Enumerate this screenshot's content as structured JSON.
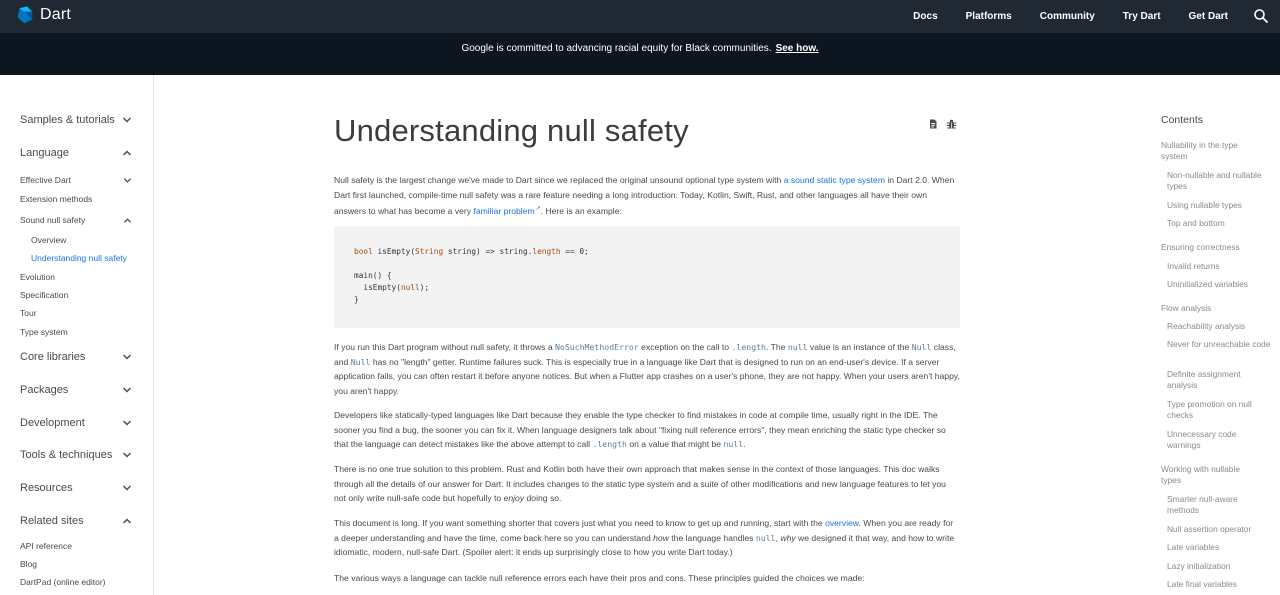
{
  "header": {
    "brand": "Dart",
    "nav": [
      "Docs",
      "Platforms",
      "Community",
      "Try Dart",
      "Get Dart"
    ]
  },
  "banner": {
    "text": "Google is committed to advancing racial equity for Black communities.",
    "link": "See how."
  },
  "sidebar": {
    "samples": "Samples & tutorials",
    "language": "Language",
    "effective_dart": "Effective Dart",
    "extension_methods": "Extension methods",
    "sound_null_safety": "Sound null safety",
    "overview": "Overview",
    "understanding": "Understanding null safety",
    "evolution": "Evolution",
    "specification": "Specification",
    "tour": "Tour",
    "type_system": "Type system",
    "core_libraries": "Core libraries",
    "packages": "Packages",
    "development": "Development",
    "tools": "Tools & techniques",
    "resources": "Resources",
    "related_sites": "Related sites",
    "api_reference": "API reference",
    "blog": "Blog",
    "dartpad": "DartPad (online editor)"
  },
  "main": {
    "title": "Understanding null safety",
    "p1": {
      "a": "Null safety is the largest change we've made to Dart since we replaced the original unsound optional type system with ",
      "link1": "a sound static type system",
      "b": " in Dart 2.0. When Dart first launched, compile-time null safety was a rare feature needing a long introduction. Today, Kotlin, Swift, Rust, and other languages all have their own answers to what has become a very ",
      "link2": "familiar problem",
      "c": ". Here is an example:"
    },
    "code": {
      "line1_kw": "bool",
      "line1_a": " isEmpty(",
      "line1_ty": "String",
      "line1_b": " string) => string.",
      "line1_prop": "length",
      "line1_c": " == 0;",
      "line3": "main() {",
      "line4_a": "  isEmpty(",
      "line4_kw": "null",
      "line4_b": ");",
      "line5": "}"
    },
    "p2": {
      "a": "If you run this Dart program without null safety, it throws a ",
      "c1": "NoSuchMethodError",
      "b": " exception on the call to ",
      "c2": ".length",
      "c": ". The ",
      "c3": "null",
      "d": " value is an instance of the ",
      "c4": "Null",
      "e": " class, and ",
      "c5": "Null",
      "f": " has no \"length\" getter. Runtime failures suck. This is especially true in a language like Dart that is designed to run on an end-user's device. If a server application fails, you can often restart it before anyone notices. But when a Flutter app crashes on a user's phone, they are not happy. When your users aren't happy, you aren't happy."
    },
    "p3": {
      "a": "Developers like statically-typed languages like Dart because they enable the type checker to find mistakes in code at compile time, usually right in the IDE. The sooner you find a bug, the sooner you can fix it. When language designers talk about \"fixing null reference errors\", they mean enriching the static type checker so that the language can detect mistakes like the above attempt to call ",
      "c1": ".length",
      "b": " on a value that might be ",
      "c2": "null",
      "c": "."
    },
    "p4": {
      "a": "There is no one true solution to this problem. Rust and Kotlin both have their own approach that makes sense in the context of those languages. This doc walks through all the details of our answer for Dart. It includes changes to the static type system and a suite of other modifications and new language features to let you not only write null-safe code but hopefully to ",
      "em": "enjoy",
      "b": " doing so."
    },
    "p5": {
      "a": "This document is long. If you want something shorter that covers just what you need to know to get up and running, start with the ",
      "link": "overview",
      "b": ". When you are ready for a deeper understanding and have the time, come back here so you can understand ",
      "em1": "how",
      "c": " the language handles ",
      "c1": "null",
      "d": ", ",
      "em2": "why",
      "e": " we designed it that way, and how to write idiomatic, modern, null-safe Dart. (Spoiler alert: it ends up surprisingly close to how you write Dart today.)"
    },
    "p6": "The various ways a language can tackle null reference errors each have their pros and cons. These principles guided the choices we made:"
  },
  "toc": {
    "title": "Contents",
    "items": [
      "Nullability in the type system",
      "Non-nullable and nullable types",
      "Using nullable types",
      "Top and bottom",
      "Ensuring correctness",
      "Invalid returns",
      "Uninitialized variables",
      "Flow analysis",
      "Reachability analysis",
      "Never for unreachable code",
      "Definite assignment analysis",
      "Type promotion on null checks",
      "Unnecessary code warnings",
      "Working with nullable types",
      "Smarter null-aware methods",
      "Null assertion operator",
      "Late variables",
      "Lazy initialization",
      "Late final variables"
    ]
  },
  "colors": {
    "topbar": "#202933",
    "banner": "#0d1520",
    "link": "#1a73e8",
    "code_bg": "#f3f3f3"
  }
}
